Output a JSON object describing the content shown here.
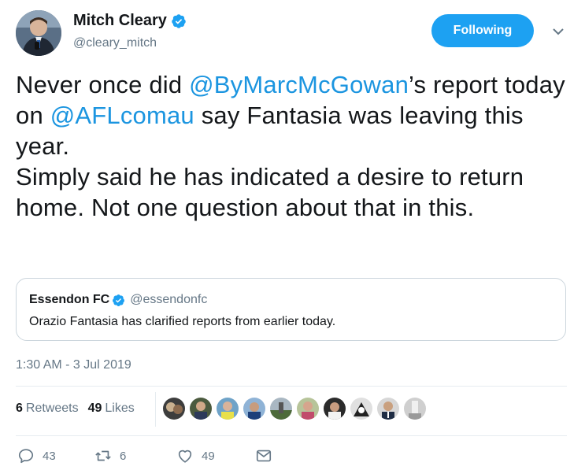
{
  "author": {
    "display_name": "Mitch Cleary",
    "handle": "@cleary_mitch",
    "verified": true
  },
  "follow_button": {
    "label": "Following",
    "color": "#1da1f2"
  },
  "tweet": {
    "segments": [
      {
        "text": "Never once did ",
        "type": "text"
      },
      {
        "text": "@ByMarcMcGowan",
        "type": "mention"
      },
      {
        "text": "’s report today on ",
        "type": "text"
      },
      {
        "text": "@AFLcomau",
        "type": "mention"
      },
      {
        "text": " say Fantasia was leaving this year.",
        "type": "text"
      },
      {
        "text": "Simply said he has indicated a desire to return home. Not one question about that in this.",
        "type": "text"
      }
    ]
  },
  "quoted_tweet": {
    "display_name": "Essendon FC",
    "handle": "@essendonfc",
    "verified": true,
    "text": "Orazio Fantasia has clarified reports from earlier today."
  },
  "timestamp": "1:30 AM - 3 Jul 2019",
  "stats": {
    "retweets_count": "6",
    "retweets_label": "Retweets",
    "likes_count": "49",
    "likes_label": "Likes"
  },
  "likers_avatar_count": 10,
  "actions": {
    "replies": "43",
    "retweets": "6",
    "likes": "49"
  },
  "colors": {
    "mention": "#1b95e0",
    "secondary_text": "#657786",
    "verified_badge": "#1da1f2"
  }
}
